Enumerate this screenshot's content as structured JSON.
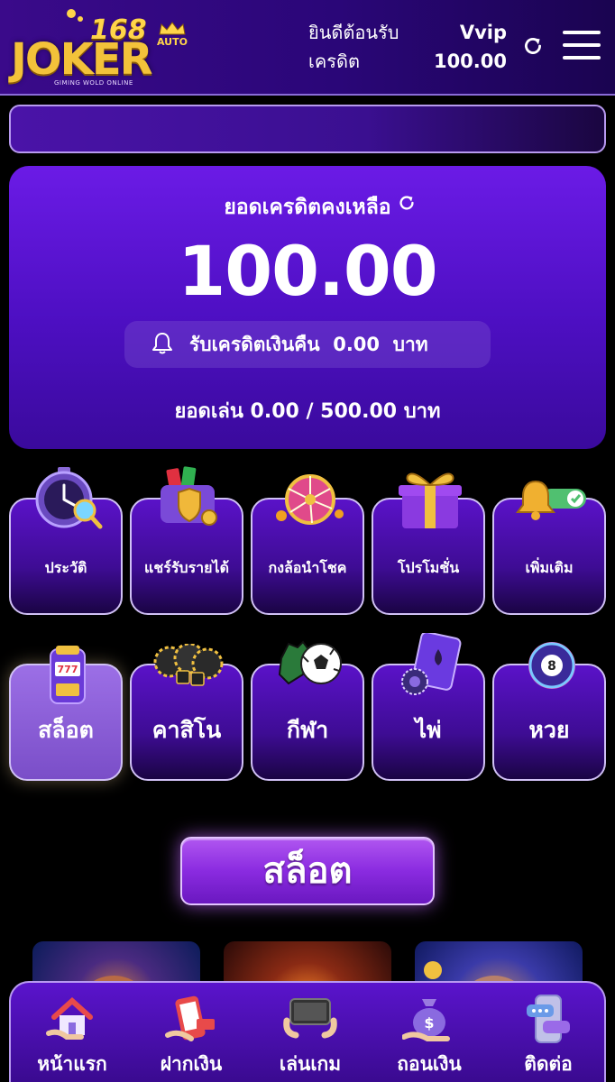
{
  "header": {
    "logo": {
      "number": "168",
      "wordmark": "JOKER",
      "badge": "AUTO",
      "tagline": "GIMING WOLD ONLINE"
    },
    "welcome_label": "ยินดีต้อนรับ",
    "credit_label": "เครดิต",
    "username": "Vvip",
    "credit_value": "100.00"
  },
  "balance": {
    "title": "ยอดเครดิตคงเหลือ",
    "amount": "100.00",
    "cashback_label": "รับเครดิตเงินคืน",
    "cashback_value": "0.00",
    "cashback_unit": "บาท",
    "turnover_text": "ยอดเล่น 0.00 / 500.00 บาท"
  },
  "menu": [
    {
      "label": "ประวัติ",
      "icon": "stopwatch-magnifier-icon"
    },
    {
      "label": "แชร์รับรายได้",
      "icon": "wallet-shield-icon"
    },
    {
      "label": "กงล้อนำโชค",
      "icon": "prize-wheel-icon"
    },
    {
      "label": "โปรโมชั่น",
      "icon": "gift-box-icon"
    },
    {
      "label": "เพิ่มเติม",
      "icon": "bell-toggle-icon"
    }
  ],
  "categories": [
    {
      "label": "สล็อต",
      "icon": "slot-machine-icon",
      "active": true
    },
    {
      "label": "คาสิโน",
      "icon": "casino-chips-icon",
      "active": false
    },
    {
      "label": "กีฬา",
      "icon": "soccer-ball-icon",
      "active": false
    },
    {
      "label": "ไพ่",
      "icon": "playing-cards-icon",
      "active": false
    },
    {
      "label": "หวย",
      "icon": "lottery-ball-icon",
      "active": false
    }
  ],
  "section_button": "สล็อต",
  "bottom_nav": [
    {
      "label": "หน้าแรก",
      "icon": "home-icon"
    },
    {
      "label": "ฝากเงิน",
      "icon": "deposit-phone-icon"
    },
    {
      "label": "เล่นเกม",
      "icon": "game-phone-icon"
    },
    {
      "label": "ถอนเงิน",
      "icon": "money-bag-icon"
    },
    {
      "label": "ติดต่อ",
      "icon": "chat-phone-icon"
    }
  ],
  "colors": {
    "accent": "#6b1be6",
    "header_bg": "#2a0678",
    "button": "#8a2be0",
    "logo_gold": "#f3c23a"
  }
}
